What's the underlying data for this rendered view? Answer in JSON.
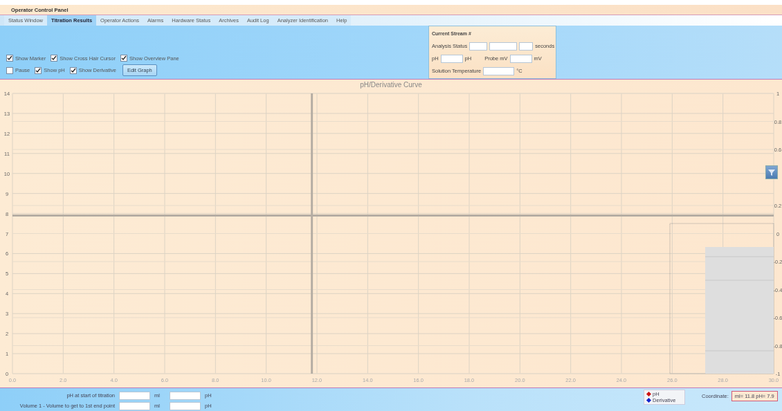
{
  "window": {
    "title": "Operator Control Panel"
  },
  "tabs": [
    {
      "label": "Status Window",
      "selected": false
    },
    {
      "label": "Titration Results",
      "selected": true
    },
    {
      "label": "Operator Actions",
      "selected": false
    },
    {
      "label": "Alarms",
      "selected": false
    },
    {
      "label": "Hardware Status",
      "selected": false
    },
    {
      "label": "Archives",
      "selected": false
    },
    {
      "label": "Audit Log",
      "selected": false
    },
    {
      "label": "Analyzer Identification",
      "selected": false
    },
    {
      "label": "Help",
      "selected": false
    }
  ],
  "options_row_1": [
    {
      "label": "Show Marker",
      "checked": true
    },
    {
      "label": "Show Cross Hair Cursor",
      "checked": true
    },
    {
      "label": "Show Overview Pane",
      "checked": true
    }
  ],
  "options_row_2": [
    {
      "label": "Pause",
      "checked": false
    },
    {
      "label": "Show pH",
      "checked": true
    },
    {
      "label": "Show Derivative",
      "checked": true
    }
  ],
  "edit_button": "Edit Graph",
  "stream_panel": {
    "title": "Current Stream #",
    "analysis_status_label": "Analysis Status",
    "seconds_unit": "seconds",
    "ph_label": "pH",
    "ph_unit": "pH",
    "probe_label": "Probe mV",
    "probe_unit": "mV",
    "temperature_label": "Solution Temperature",
    "temperature_unit": "°C"
  },
  "chart": {
    "chart_data": {
      "type": "line",
      "title": "pH/Derivative Curve",
      "xlim": [
        0,
        30
      ],
      "ylim": [
        0,
        14
      ],
      "xticks": [
        {
          "value": 0,
          "label": "0.0"
        },
        {
          "value": 2,
          "label": "2.0"
        },
        {
          "value": 4,
          "label": "4.0"
        },
        {
          "value": 6,
          "label": "6.0"
        },
        {
          "value": 8,
          "label": "8.0"
        },
        {
          "value": 10,
          "label": "10.0"
        },
        {
          "value": 12,
          "label": "12.0"
        },
        {
          "value": 14,
          "label": "14.0"
        },
        {
          "value": 16,
          "label": "16.0"
        },
        {
          "value": 18,
          "label": "18.0"
        },
        {
          "value": 20,
          "label": "20.0"
        },
        {
          "value": 22,
          "label": "22.0"
        },
        {
          "value": 24,
          "label": "24.0"
        },
        {
          "value": 26,
          "label": "26.0"
        },
        {
          "value": 28,
          "label": "28.0"
        },
        {
          "value": 30,
          "label": "30.0"
        }
      ],
      "yticks": [
        0,
        1,
        2,
        3,
        4,
        5,
        6,
        7,
        8,
        9,
        10,
        11,
        12,
        13,
        14
      ],
      "grid": true,
      "ref_lines": [
        {
          "axis": "x",
          "value": 11.8
        },
        {
          "axis": "y",
          "value": 7.9
        }
      ]
    },
    "right_axis_labels": [
      "1",
      "0.8",
      "0.6",
      "0.2",
      "0",
      "-0.2",
      "-0.4",
      "-0.6",
      "-0.8",
      "-1"
    ]
  },
  "results": [
    {
      "label": "pH at start of titration",
      "unit_1": "ml",
      "unit_2": "pH"
    },
    {
      "label": "Volume 1 - Volume to get to 1st end point",
      "unit_1": "ml",
      "unit_2": "pH"
    }
  ],
  "legend": [
    {
      "label": "pH",
      "color": "#cc1111"
    },
    {
      "label": "Derivative",
      "color": "#1122cc"
    }
  ],
  "coordinate": {
    "label": "Coordinate:",
    "value": "ml= 11.8 pH= 7.9"
  }
}
